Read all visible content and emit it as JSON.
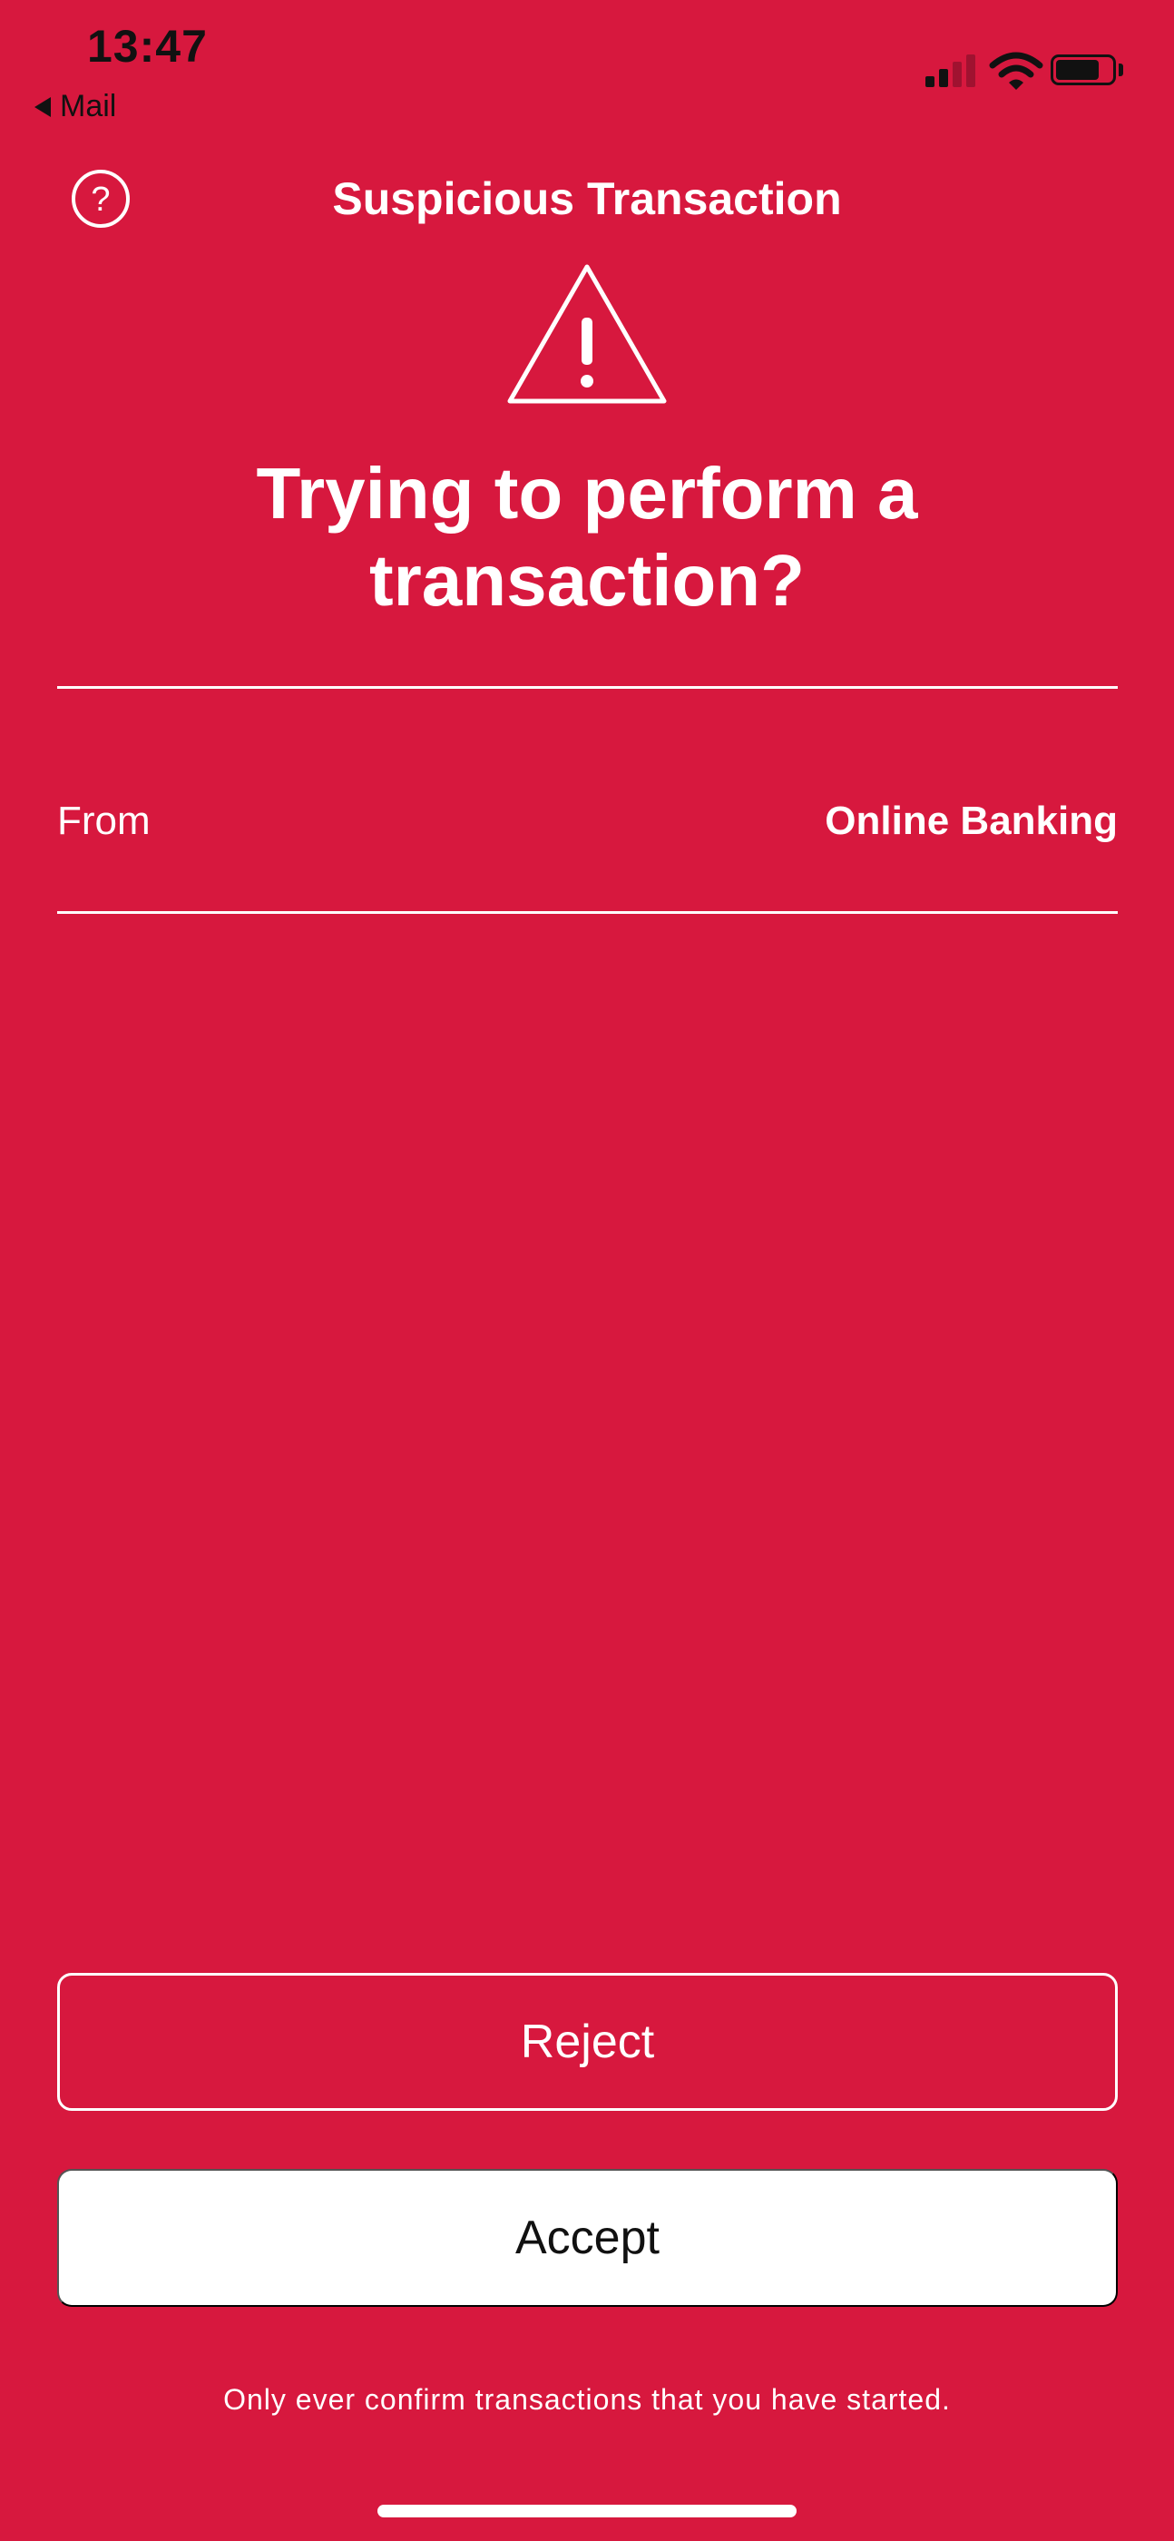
{
  "status_bar": {
    "time": "13:47",
    "back_label": "Mail",
    "signal_icon": "cellular-signal-icon",
    "wifi_icon": "wifi-icon",
    "battery_icon": "battery-icon"
  },
  "header": {
    "title": "Suspicious Transaction",
    "help_icon": "question-circle-icon",
    "warning_icon": "warning-triangle-icon"
  },
  "headline": {
    "line1": "Trying to perform a",
    "line2": "transaction?"
  },
  "details": {
    "label": "From",
    "value": "Online Banking"
  },
  "actions": {
    "reject_label": "Reject",
    "accept_label": "Accept"
  },
  "footer": {
    "note": "Only ever confirm transactions that you have started."
  },
  "colors": {
    "background": "#D7183E",
    "text": "#FFFFFF",
    "status_text": "#111111"
  }
}
